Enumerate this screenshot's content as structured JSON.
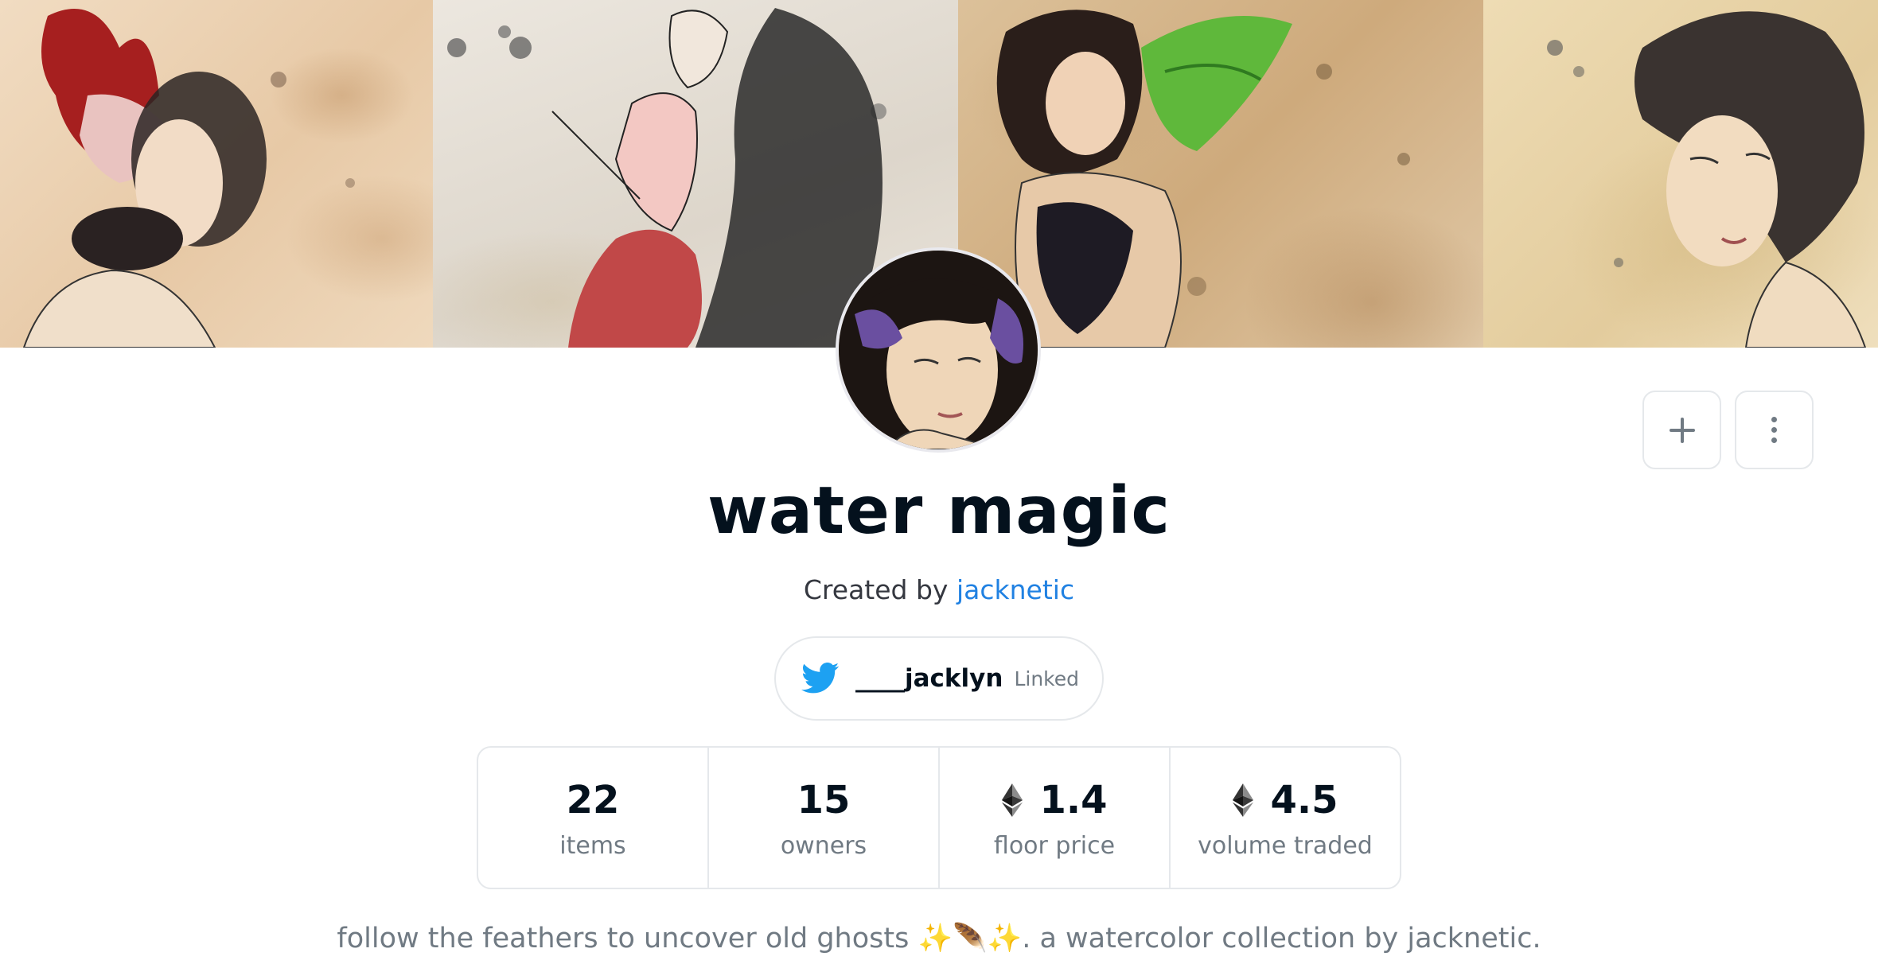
{
  "collection": {
    "title": "water magic",
    "created_by_prefix": "Created by",
    "creator_name": "jacknetic",
    "description": "follow the feathers to uncover old ghosts ✨🪶✨. a watercolor collection by jacknetic."
  },
  "twitter": {
    "icon": "twitter-bird-icon",
    "handle": "____jacklyn",
    "status": "Linked",
    "brand_color": "#1da1f2"
  },
  "actions": {
    "add_icon": "plus-icon",
    "more_icon": "more-vertical-icon"
  },
  "stats": [
    {
      "value": "22",
      "label": "items",
      "icon": ""
    },
    {
      "value": "15",
      "label": "owners",
      "icon": ""
    },
    {
      "value": "1.4",
      "label": "floor price",
      "icon": "ethereum-icon"
    },
    {
      "value": "4.5",
      "label": "volume traded",
      "icon": "ethereum-icon"
    }
  ],
  "colors": {
    "link": "#2081e2",
    "text_primary": "#04111d",
    "text_secondary": "#707a83",
    "border": "#e5e8eb"
  }
}
